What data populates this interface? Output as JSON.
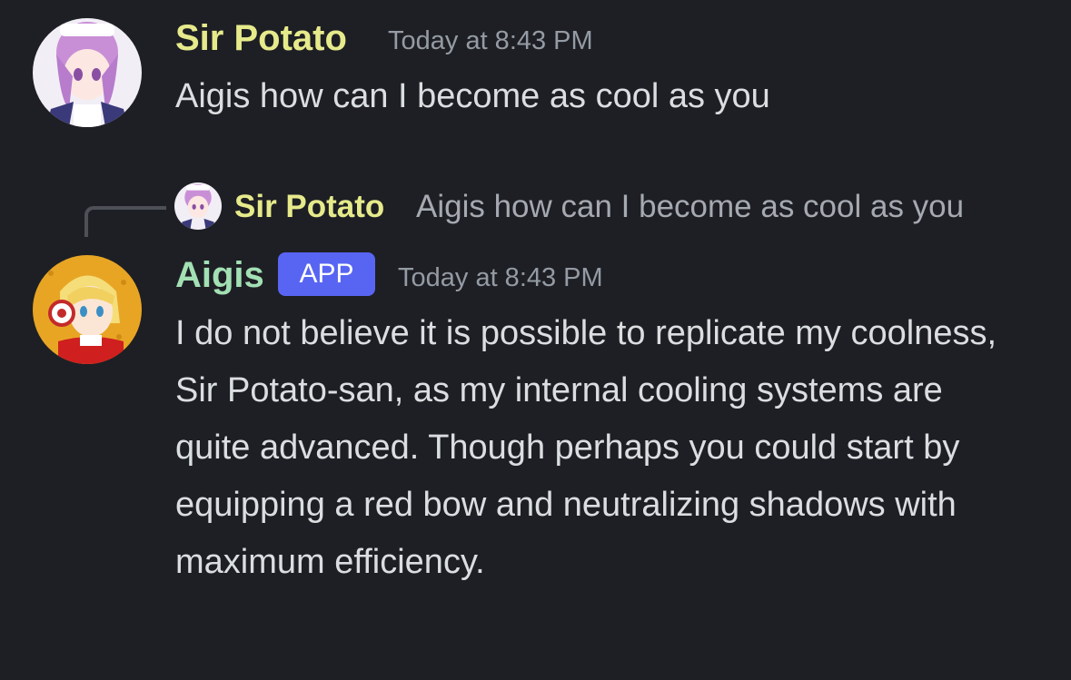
{
  "colors": {
    "background": "#1e1f24",
    "sir_potato_name": "#e6ea8b",
    "aigis_name": "#a3e0b4",
    "app_badge": "#5865f2",
    "timestamp": "#949ba4",
    "message": "#dbdee1"
  },
  "messages": [
    {
      "author": "Sir Potato",
      "avatar_icon": "sir-potato-avatar-icon",
      "timestamp": "Today at 8:43 PM",
      "text": "Aigis how can I become as cool as you"
    },
    {
      "reply": {
        "author": "Sir Potato",
        "avatar_icon": "sir-potato-avatar-icon",
        "text": "Aigis how can I become as cool as you"
      },
      "author": "Aigis",
      "badge": "APP",
      "avatar_icon": "aigis-avatar-icon",
      "timestamp": "Today at 8:43 PM",
      "text": "I do not believe it is possible to replicate my coolness, Sir Potato-san, as my internal cooling systems are quite advanced. Though perhaps you could start by equipping a red bow and neutralizing shadows with maximum efficiency."
    }
  ]
}
